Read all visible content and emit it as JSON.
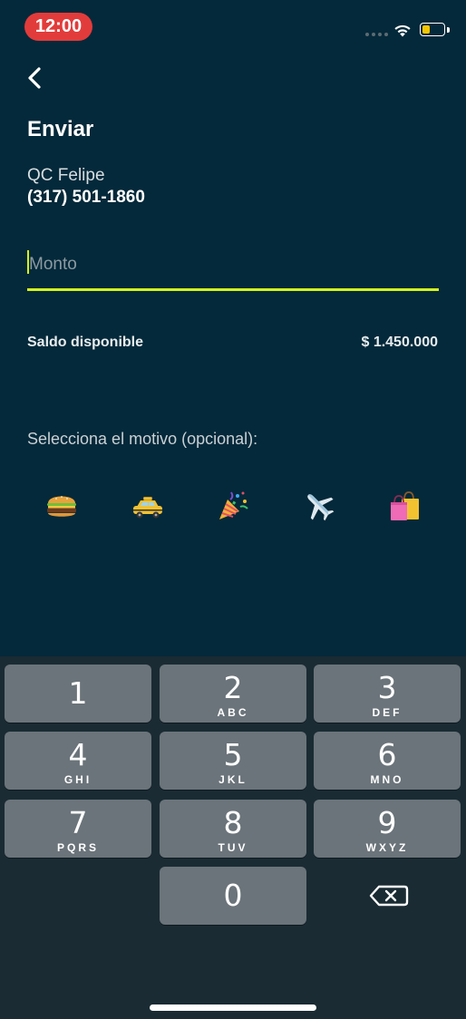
{
  "status_bar": {
    "time": "12:00",
    "battery_color": "#f7c600",
    "time_pill_color": "#e23b3b"
  },
  "header": {
    "back_icon": "chevron-left-icon",
    "title": "Enviar"
  },
  "contact": {
    "name": "QC Felipe",
    "phone": "(317) 501-1860"
  },
  "amount": {
    "placeholder": "Monto",
    "value": "",
    "accent_color": "#d4f21e"
  },
  "balance": {
    "label": "Saldo disponible",
    "value": "$ 1.450.000"
  },
  "motive": {
    "label": "Selecciona el motivo (opcional):",
    "options": [
      {
        "name": "food",
        "icon": "hamburger-icon"
      },
      {
        "name": "transport",
        "icon": "taxi-icon"
      },
      {
        "name": "party",
        "icon": "party-popper-icon"
      },
      {
        "name": "travel",
        "icon": "airplane-icon"
      },
      {
        "name": "shopping",
        "icon": "shopping-bags-icon"
      }
    ]
  },
  "keypad": {
    "keys": [
      {
        "digit": "1",
        "letters": ""
      },
      {
        "digit": "2",
        "letters": "ABC"
      },
      {
        "digit": "3",
        "letters": "DEF"
      },
      {
        "digit": "4",
        "letters": "GHI"
      },
      {
        "digit": "5",
        "letters": "JKL"
      },
      {
        "digit": "6",
        "letters": "MNO"
      },
      {
        "digit": "7",
        "letters": "PQRS"
      },
      {
        "digit": "8",
        "letters": "TUV"
      },
      {
        "digit": "9",
        "letters": "WXYZ"
      },
      {
        "digit": "0",
        "letters": ""
      }
    ],
    "backspace_icon": "backspace-icon"
  }
}
